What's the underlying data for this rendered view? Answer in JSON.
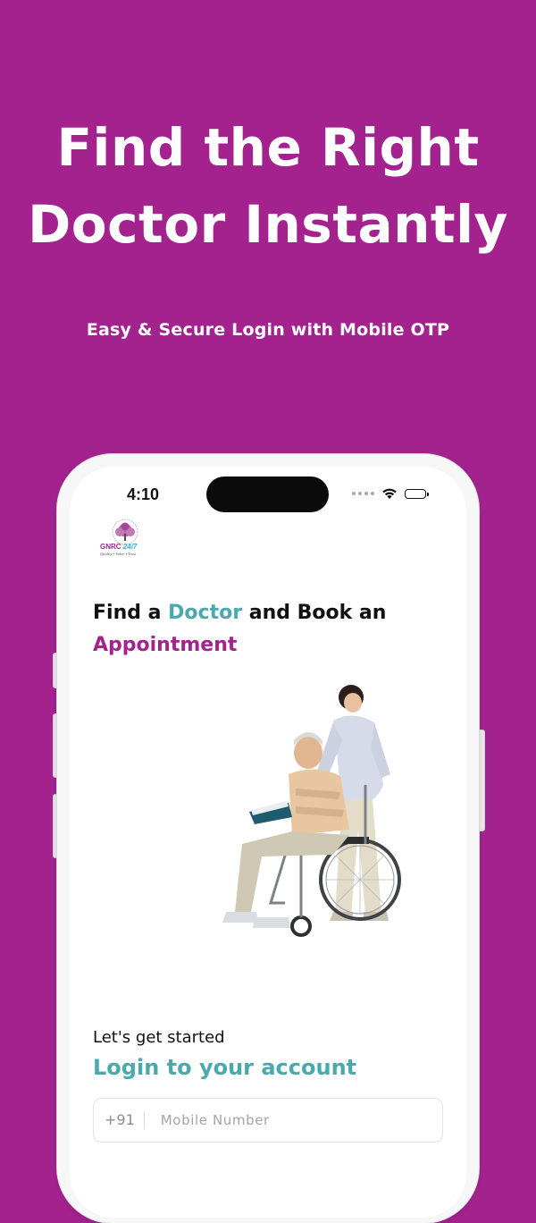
{
  "promo": {
    "headline_line1": "Find the Right",
    "headline_line2": "Doctor Instantly",
    "subheadline": "Easy & Secure Login with Mobile OTP",
    "background_color": "#a3228e"
  },
  "status_bar": {
    "time": "4:10",
    "icons": [
      "signal-dots-icon",
      "wifi-icon",
      "battery-icon"
    ]
  },
  "app": {
    "logo": {
      "brand_a": "GNRC",
      "brand_b": "24/7",
      "tagline": "Quality • Value • Trust"
    },
    "hero": {
      "part1": "Find a ",
      "highlight1": "Doctor",
      "part2": " and Book an",
      "highlight2": "Appointment"
    },
    "login": {
      "intro": "Let's get started",
      "title": "Login to your account",
      "country_code": "+91",
      "mobile_placeholder": "Mobile Number",
      "mobile_value": ""
    },
    "colors": {
      "teal": "#4aa9ad",
      "purple": "#a3228e"
    }
  }
}
